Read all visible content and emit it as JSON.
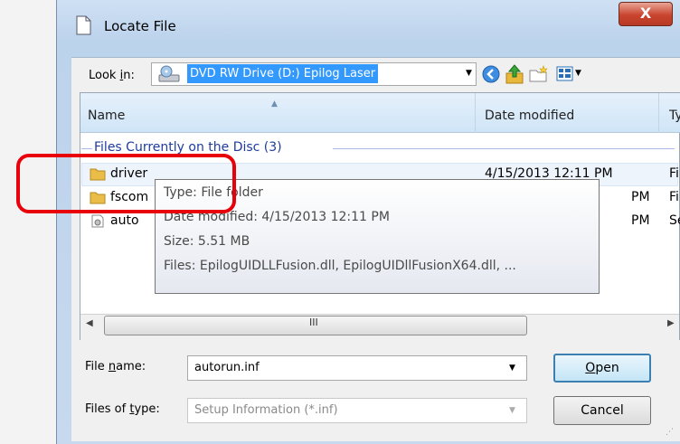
{
  "window": {
    "title": "Locate File",
    "close_glyph": "X"
  },
  "lookin": {
    "label_pre": "Look ",
    "label_mnemonic": "i",
    "label_post": "n:",
    "value": "DVD RW Drive (D:) Epilog Laser"
  },
  "toolbar_icons": [
    "back-icon",
    "up-folder-icon",
    "new-folder-icon",
    "view-menu-icon"
  ],
  "columns": {
    "name": "Name",
    "date": "Date modified",
    "type": "Ty"
  },
  "group_header": "Files Currently on the Disc (3)",
  "rows": [
    {
      "name": "driver",
      "date": "4/15/2013 12:11 PM",
      "type": "Fi"
    },
    {
      "name": "fscom",
      "date": "PM",
      "type": "Fi"
    },
    {
      "name": "auto",
      "date": "PM",
      "type": "Se"
    }
  ],
  "tooltip": {
    "line1": "Type: File folder",
    "line2": "Date modified: 4/15/2013 12:11 PM",
    "line3": "Size: 5.51 MB",
    "line4": "Files: EpilogUIDLLFusion.dll, EpilogUIDllFusionX64.dll, ..."
  },
  "filename": {
    "label_pre": "File ",
    "label_mnemonic": "n",
    "label_post": "ame:",
    "value": "autorun.inf"
  },
  "filetype": {
    "label_pre": "Files of ",
    "label_mnemonic": "t",
    "label_post": "ype:",
    "value": "Setup Information (*.inf)"
  },
  "buttons": {
    "open_mnemonic": "O",
    "open_rest": "pen",
    "cancel": "Cancel"
  },
  "colors": {
    "highlight": "#3399ff",
    "annotation": "#e8000b",
    "group_text": "#1e3c9e"
  }
}
